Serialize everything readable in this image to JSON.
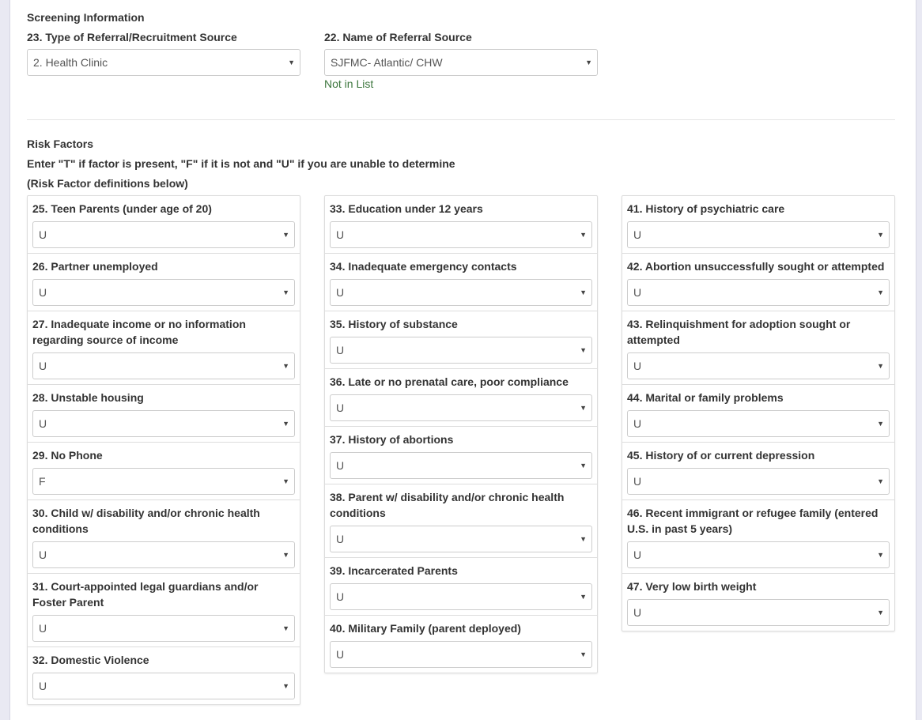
{
  "screening": {
    "heading": "Screening Information",
    "referral_type": {
      "label": "23. Type of Referral/Recruitment Source",
      "value": "2. Health Clinic"
    },
    "referral_name": {
      "label": "22. Name of Referral Source",
      "value": "SJFMC- Atlantic/ CHW",
      "not_in_list": "Not in List"
    }
  },
  "risk": {
    "heading": "Risk Factors",
    "instructions": "Enter \"T\" if factor is present, \"F\" if it is not and \"U\" if you are unable to determine",
    "definitions_note": "(Risk Factor definitions below)",
    "columns": [
      [
        {
          "label": "25. Teen Parents (under age of 20)",
          "value": "U"
        },
        {
          "label": "26. Partner unemployed",
          "value": "U"
        },
        {
          "label": "27. Inadequate income or no information regarding source of income",
          "value": "U"
        },
        {
          "label": "28. Unstable housing",
          "value": "U"
        },
        {
          "label": "29. No Phone",
          "value": "F"
        },
        {
          "label": "30. Child w/ disability and/or chronic health conditions",
          "value": "U"
        },
        {
          "label": "31. Court-appointed legal guardians and/or Foster Parent",
          "value": "U"
        },
        {
          "label": "32. Domestic Violence",
          "value": "U"
        }
      ],
      [
        {
          "label": "33. Education under 12 years",
          "value": "U"
        },
        {
          "label": "34. Inadequate emergency contacts",
          "value": "U"
        },
        {
          "label": "35. History of substance",
          "value": "U"
        },
        {
          "label": "36. Late or no prenatal care, poor compliance",
          "value": "U"
        },
        {
          "label": "37. History of abortions",
          "value": "U"
        },
        {
          "label": "38. Parent w/ disability and/or chronic health conditions",
          "value": "U"
        },
        {
          "label": "39. Incarcerated Parents",
          "value": "U"
        },
        {
          "label": "40. Military Family (parent deployed)",
          "value": "U"
        }
      ],
      [
        {
          "label": "41. History of psychiatric care",
          "value": "U"
        },
        {
          "label": "42. Abortion unsuccessfully sought or attempted",
          "value": "U"
        },
        {
          "label": "43. Relinquishment for adoption sought or attempted",
          "value": "U"
        },
        {
          "label": "44. Marital or family problems",
          "value": "U"
        },
        {
          "label": "45. History of or current depression",
          "value": "U"
        },
        {
          "label": "46. Recent immigrant or refugee family (entered U.S. in past 5 years)",
          "value": "U"
        },
        {
          "label": "47. Very low birth weight",
          "value": "U"
        }
      ]
    ]
  },
  "icons": {
    "dropdown": "caret-down-icon"
  }
}
